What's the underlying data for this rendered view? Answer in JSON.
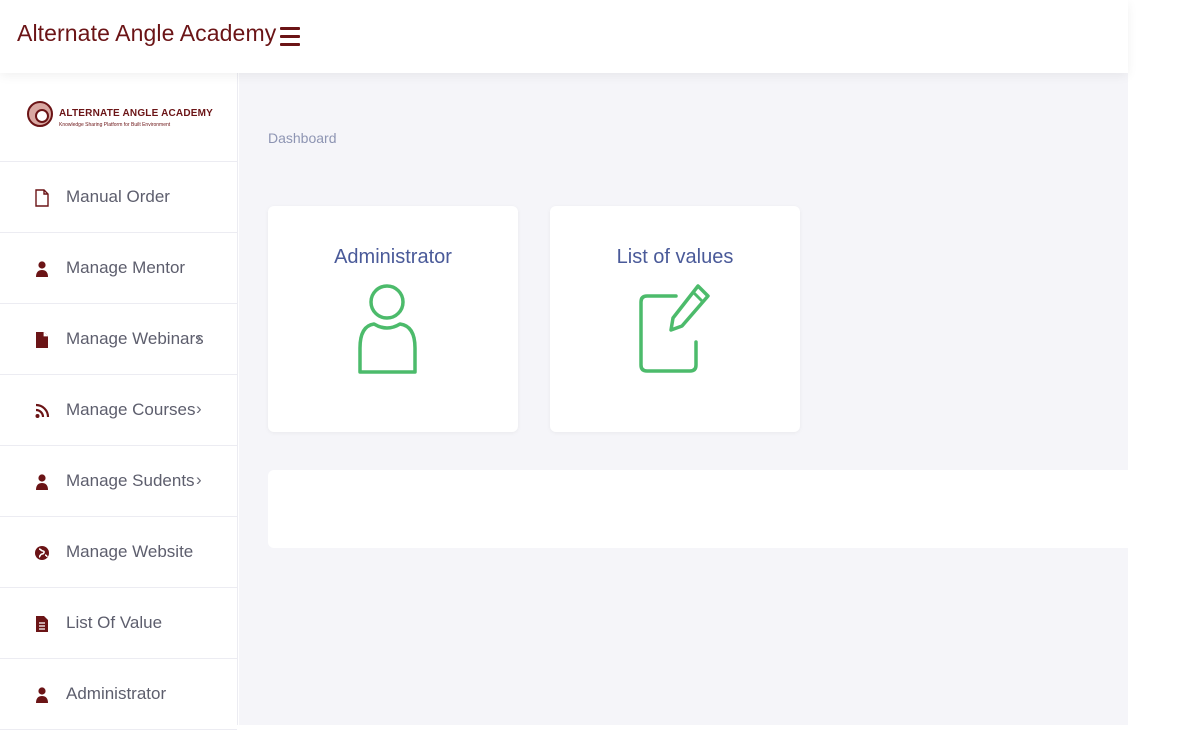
{
  "header": {
    "title": "Alternate Angle Academy",
    "menu_icon": "hamburger-icon"
  },
  "brand": {
    "name": "ALTERNATE ANGLE ACADEMY",
    "tagline": "Knowledge Sharing Platform for Built Environment"
  },
  "sidebar": {
    "items": [
      {
        "label": "Manual Order",
        "icon": "file-outline-icon",
        "has_submenu": false
      },
      {
        "label": "Manage Mentor",
        "icon": "user-icon",
        "has_submenu": false
      },
      {
        "label": "Manage Webinars",
        "icon": "file-icon",
        "has_submenu": true
      },
      {
        "label": "Manage Courses",
        "icon": "rss-icon",
        "has_submenu": true
      },
      {
        "label": "Manage Sudents",
        "icon": "user-icon",
        "has_submenu": true
      },
      {
        "label": "Manage Website",
        "icon": "globe-icon",
        "has_submenu": false
      },
      {
        "label": "List Of Value",
        "icon": "file-text-icon",
        "has_submenu": false
      },
      {
        "label": "Administrator",
        "icon": "user-icon",
        "has_submenu": false
      }
    ],
    "chevron": "›"
  },
  "breadcrumb": "Dashboard",
  "cards": [
    {
      "title": "Administrator",
      "icon": "user-outline-icon"
    },
    {
      "title": "List of values",
      "icon": "edit-icon"
    }
  ],
  "colors": {
    "brand": "#6b1416",
    "card_title": "#4a5a99",
    "icon_green": "#4cbb6b",
    "background": "#f5f5f9",
    "muted_text": "#8e95b3"
  }
}
